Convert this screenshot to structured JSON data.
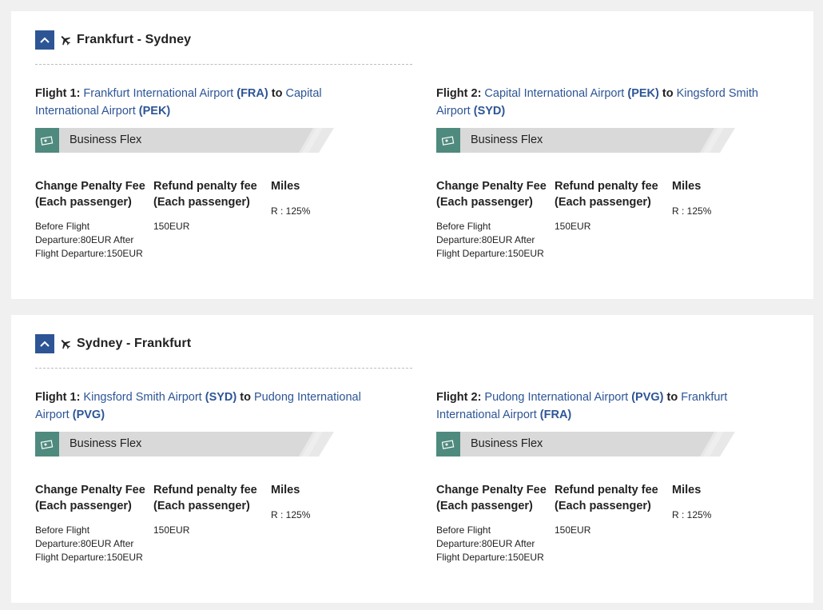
{
  "colors": {
    "accent_blue": "#2d5596",
    "fare_icon_green": "#4f8a7e",
    "fare_bar_gray": "#d9d9d9",
    "page_bg": "#f0f0f0",
    "card_bg": "#ffffff"
  },
  "icons": {
    "toggle": "chevron-up-icon",
    "route": "airplane-icon",
    "fare": "ticket-icon"
  },
  "labels": {
    "to": "to",
    "change_head_1": "Change Penalty Fee",
    "change_head_2": "(Each passenger)",
    "refund_head_1": "Refund penalty fee",
    "refund_head_2": "(Each passenger)",
    "miles_head": "Miles"
  },
  "routes": [
    {
      "title": "Frankfurt - Sydney",
      "flights": [
        {
          "label": "Flight 1",
          "from_name": "Frankfurt International Airport",
          "from_code": "(FRA)",
          "to_name": "Capital International Airport",
          "to_code": "(PEK)",
          "fare": "Business Flex",
          "change_fee": "Before Flight Departure:80EUR After Flight Departure:150EUR",
          "refund_fee": "150EUR",
          "miles": "R : 125%"
        },
        {
          "label": "Flight 2",
          "from_name": "Capital International Airport",
          "from_code": "(PEK)",
          "to_name": "Kingsford Smith Airport",
          "to_code": "(SYD)",
          "fare": "Business Flex",
          "change_fee": "Before Flight Departure:80EUR After Flight Departure:150EUR",
          "refund_fee": "150EUR",
          "miles": "R : 125%"
        }
      ]
    },
    {
      "title": "Sydney - Frankfurt",
      "flights": [
        {
          "label": "Flight 1",
          "from_name": "Kingsford Smith Airport",
          "from_code": "(SYD)",
          "to_name": "Pudong International Airport",
          "to_code": "(PVG)",
          "fare": "Business Flex",
          "change_fee": "Before Flight Departure:80EUR After Flight Departure:150EUR",
          "refund_fee": "150EUR",
          "miles": "R : 125%"
        },
        {
          "label": "Flight 2",
          "from_name": "Pudong International Airport",
          "from_code": "(PVG)",
          "to_name": "Frankfurt International Airport",
          "to_code": "(FRA)",
          "fare": "Business Flex",
          "change_fee": "Before Flight Departure:80EUR After Flight Departure:150EUR",
          "refund_fee": "150EUR",
          "miles": "R : 125%"
        }
      ]
    }
  ]
}
